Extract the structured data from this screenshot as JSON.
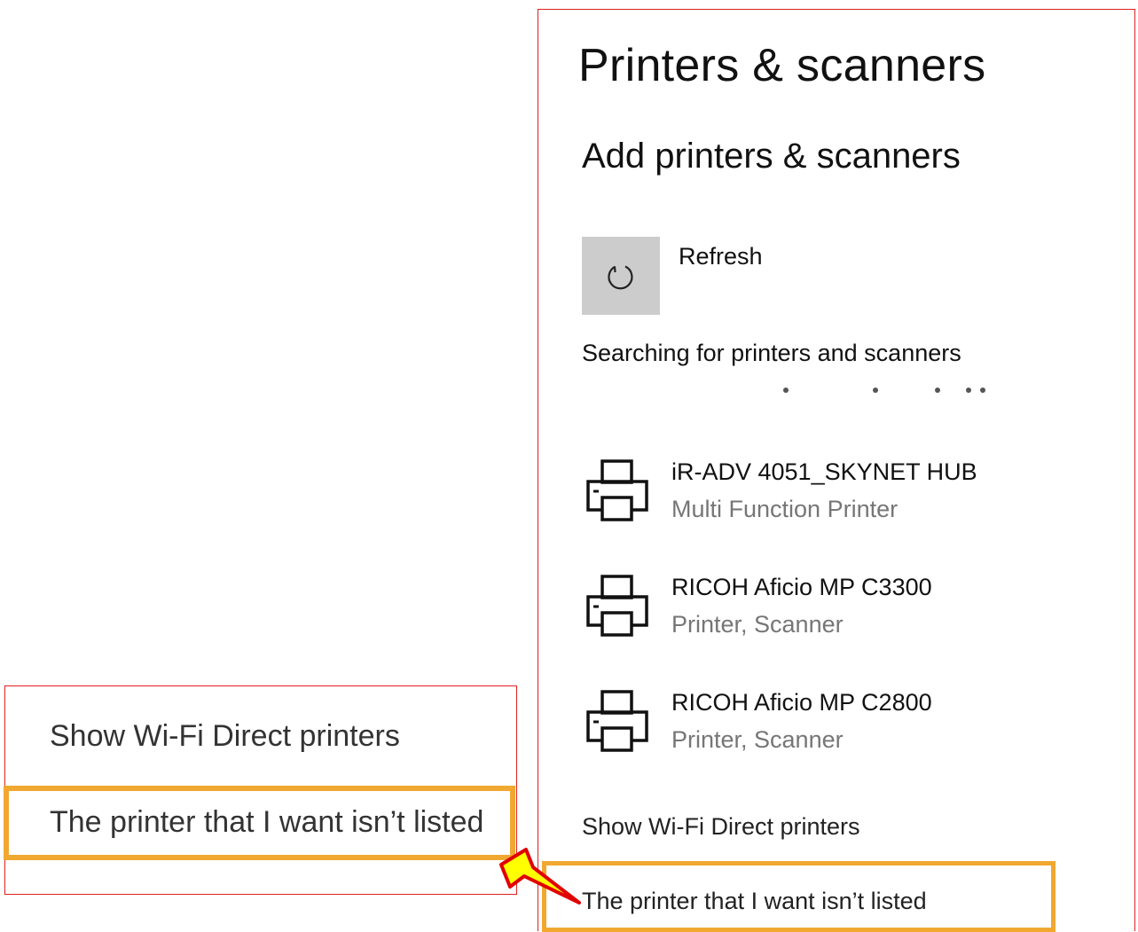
{
  "header": {
    "title": "Printers & scanners",
    "section_title": "Add printers & scanners"
  },
  "refresh": {
    "label": "Refresh",
    "icon": "refresh-icon"
  },
  "search_status": "Searching for printers and scanners",
  "devices": [
    {
      "name": "iR-ADV 4051_SKYNET HUB",
      "type": "Multi Function Printer",
      "icon": "printer-icon"
    },
    {
      "name": "RICOH Aficio MP C3300",
      "type": "Printer, Scanner",
      "icon": "printer-icon"
    },
    {
      "name": "RICOH Aficio MP C2800",
      "type": "Printer, Scanner",
      "icon": "printer-icon"
    }
  ],
  "links": {
    "wifi_direct": "Show Wi-Fi Direct printers",
    "not_listed": "The printer that I want isn’t listed"
  },
  "zoom_callout": {
    "wifi_direct": "Show Wi-Fi Direct printers",
    "not_listed": "The printer that I want isn’t listed"
  },
  "colors": {
    "callout_border": "#e02020",
    "highlight_border": "#f0a830",
    "arrow_fill": "#ffff00",
    "arrow_stroke": "#e00000",
    "refresh_bg": "#cccccc",
    "secondary_text": "#767676"
  }
}
